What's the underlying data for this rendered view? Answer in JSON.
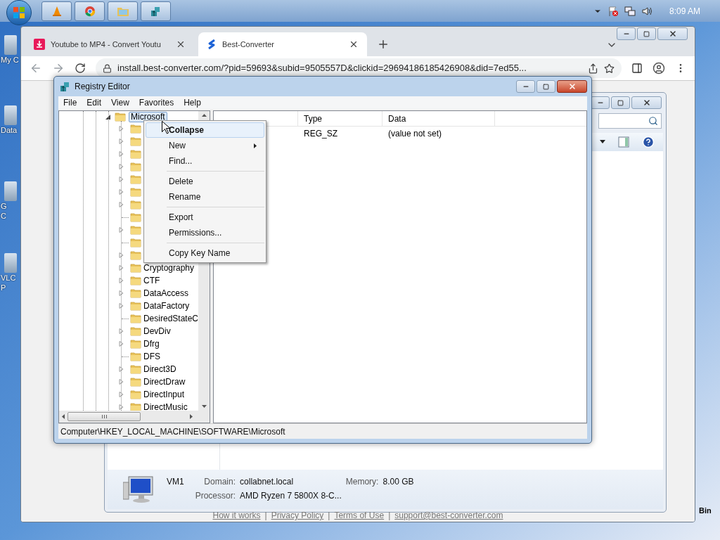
{
  "taskbar": {
    "clock": "8:09 AM"
  },
  "desktop_icons": [
    {
      "lines": [
        "My C"
      ]
    },
    {
      "lines": [
        "Data"
      ]
    },
    {
      "lines": [
        "G",
        "C"
      ]
    },
    {
      "lines": [
        "VLC",
        "P"
      ]
    }
  ],
  "desktop_icon_right": {
    "label": "Bin"
  },
  "browser": {
    "tabs": [
      {
        "title": "Youtube to MP4 - Convert Youtu",
        "selected": false
      },
      {
        "title": "Best-Converter",
        "selected": true
      }
    ],
    "url": "install.best-converter.com/?pid=59693&subid=9505557D&clickid=29694186185426908&did=7ed55...",
    "footer_links": [
      "How it works",
      "Privacy Policy",
      "Terms of Use",
      "support@best-converter.com"
    ],
    "footer_separator": "|"
  },
  "explorer_details": {
    "name": "VM1",
    "fields": [
      {
        "label": "Domain:",
        "value": "collabnet.local"
      },
      {
        "label": "Memory:",
        "value": "8.00 GB"
      },
      {
        "label": "Processor:",
        "value": "AMD Ryzen 7 5800X 8-C..."
      }
    ]
  },
  "registry": {
    "title": "Registry Editor",
    "menu": [
      "File",
      "Edit",
      "View",
      "Favorites",
      "Help"
    ],
    "tree": {
      "label": "Microsoft",
      "expanded": true,
      "selected": true,
      "children": [
        {
          "expandable": true
        },
        {
          "expandable": true
        },
        {
          "expandable": true
        },
        {
          "expandable": true
        },
        {
          "expandable": true
        },
        {
          "expandable": true
        },
        {
          "expandable": true
        },
        {
          "expandable": false
        },
        {
          "expandable": true
        },
        {
          "expandable": false
        },
        {
          "expandable": true
        },
        {
          "label": "Cryptography",
          "expandable": true
        },
        {
          "label": "CTF",
          "expandable": true
        },
        {
          "label": "DataAccess",
          "expandable": true
        },
        {
          "label": "DataFactory",
          "expandable": true
        },
        {
          "label": "DesiredStateC",
          "expandable": false
        },
        {
          "label": "DevDiv",
          "expandable": true
        },
        {
          "label": "Dfrg",
          "expandable": true
        },
        {
          "label": "DFS",
          "expandable": false
        },
        {
          "label": "Direct3D",
          "expandable": true
        },
        {
          "label": "DirectDraw",
          "expandable": true
        },
        {
          "label": "DirectInput",
          "expandable": true
        },
        {
          "label": "DirectMusic",
          "expandable": true
        }
      ]
    },
    "columns": [
      "Type",
      "Data"
    ],
    "rows": [
      {
        "type": "REG_SZ",
        "data": "(value not set)"
      }
    ],
    "status": "Computer\\HKEY_LOCAL_MACHINE\\SOFTWARE\\Microsoft",
    "context_menu": [
      {
        "kind": "item",
        "label": "Collapse",
        "bold": true,
        "selected": true,
        "submenu": false
      },
      {
        "kind": "item",
        "label": "New",
        "bold": false,
        "selected": false,
        "submenu": true
      },
      {
        "kind": "item",
        "label": "Find...",
        "bold": false,
        "selected": false,
        "submenu": false
      },
      {
        "kind": "separator"
      },
      {
        "kind": "item",
        "label": "Delete",
        "bold": false,
        "selected": false,
        "submenu": false
      },
      {
        "kind": "item",
        "label": "Rename",
        "bold": false,
        "selected": false,
        "submenu": false
      },
      {
        "kind": "separator"
      },
      {
        "kind": "item",
        "label": "Export",
        "bold": false,
        "selected": false,
        "submenu": false
      },
      {
        "kind": "item",
        "label": "Permissions...",
        "bold": false,
        "selected": false,
        "submenu": false
      },
      {
        "kind": "separator"
      },
      {
        "kind": "item",
        "label": "Copy Key Name",
        "bold": false,
        "selected": false,
        "submenu": false
      }
    ]
  }
}
